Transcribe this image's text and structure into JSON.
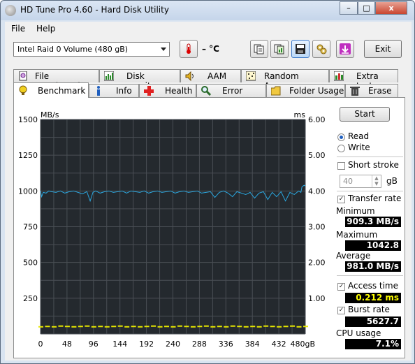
{
  "window": {
    "title": "HD Tune Pro 4.60 - Hard Disk Utility",
    "controls": {
      "minimize": "–",
      "maximize": "□",
      "close": "x"
    }
  },
  "menu": [
    {
      "label": "File"
    },
    {
      "label": "Help"
    }
  ],
  "toolbar": {
    "drive": "Intel   Raid 0 Volume (480 gB)",
    "temperature": "– °C",
    "exit_label": "Exit",
    "icons": [
      "copy-info-icon",
      "copy-screenshot-icon",
      "save-icon",
      "options-icon",
      "download-icon"
    ]
  },
  "tabs_row1": [
    {
      "label": "File Benchmark",
      "icon": "file-benchmark-icon"
    },
    {
      "label": "Disk monitor",
      "icon": "disk-monitor-icon"
    },
    {
      "label": "AAM",
      "icon": "speaker-icon"
    },
    {
      "label": "Random Access",
      "icon": "random-access-icon"
    },
    {
      "label": "Extra tests",
      "icon": "extra-tests-icon"
    }
  ],
  "tabs_row2": [
    {
      "label": "Benchmark",
      "icon": "benchmark-icon",
      "active": true
    },
    {
      "label": "Info",
      "icon": "info-icon"
    },
    {
      "label": "Health",
      "icon": "health-cross-icon"
    },
    {
      "label": "Error Scan",
      "icon": "magnifier-icon"
    },
    {
      "label": "Folder Usage",
      "icon": "folder-icon"
    },
    {
      "label": "Erase",
      "icon": "trash-icon"
    }
  ],
  "side": {
    "start_label": "Start",
    "read_label": "Read",
    "write_label": "Write",
    "mode": "read",
    "short_stroke_label": "Short stroke",
    "short_stroke_checked": false,
    "stroke_value": "40",
    "stroke_unit": "gB",
    "transfer_rate_label": "Transfer rate",
    "transfer_rate_checked": true,
    "minimum_label": "Minimum",
    "minimum_value": "909.3 MB/s",
    "maximum_label": "Maximum",
    "maximum_value": "1042.8 MB/s",
    "average_label": "Average",
    "average_value": "981.0 MB/s",
    "access_time_label": "Access time",
    "access_time_checked": true,
    "access_time_value": "0.212 ms",
    "burst_rate_label": "Burst rate",
    "burst_rate_checked": true,
    "burst_rate_value": "5627.7 MB/s",
    "cpu_label": "CPU usage",
    "cpu_value": "7.1%"
  },
  "colors": {
    "plot_bg": "#24292e",
    "grid": "#4a4f55",
    "transfer_line": "#2aa6de",
    "access_points": "#e6e600",
    "value_yellow": "#ffff00"
  },
  "chart_data": {
    "type": "line",
    "ylabel": "MB/s",
    "y2label": "ms",
    "ylim": [
      0,
      1500
    ],
    "y2lim": [
      0,
      6.0
    ],
    "xlim": [
      0,
      480
    ],
    "y_ticks": [
      "1500",
      "1250",
      "1000",
      "750",
      "500",
      "250"
    ],
    "y2_ticks": [
      "6.00",
      "5.00",
      "4.00",
      "3.00",
      "2.00",
      "1.00"
    ],
    "x_ticks": [
      "0",
      "48",
      "96",
      "144",
      "192",
      "240",
      "288",
      "336",
      "384",
      "432",
      "480gB"
    ],
    "grid": true,
    "series": [
      {
        "axis": "left",
        "x": [
          0,
          2,
          5,
          10,
          15,
          20,
          28,
          36,
          44,
          52,
          60,
          68,
          76,
          84,
          90,
          95,
          100,
          108,
          116,
          124,
          132,
          140,
          148,
          156,
          164,
          172,
          180,
          188,
          196,
          204,
          212,
          220,
          228,
          236,
          244,
          252,
          260,
          268,
          276,
          284,
          292,
          300,
          308,
          316,
          324,
          332,
          340,
          348,
          356,
          364,
          372,
          380,
          388,
          396,
          404,
          412,
          420,
          428,
          436,
          444,
          452,
          460,
          468,
          472,
          474,
          478,
          480
        ],
        "y": [
          1000,
          960,
          990,
          985,
          1000,
          995,
          990,
          1000,
          985,
          995,
          1000,
          990,
          980,
          995,
          930,
          990,
          1000,
          985,
          995,
          1000,
          990,
          995,
          1000,
          985,
          1000,
          995,
          990,
          1000,
          985,
          995,
          1000,
          990,
          995,
          1000,
          985,
          995,
          1000,
          990,
          995,
          1000,
          985,
          990,
          995,
          955,
          990,
          1000,
          985,
          960,
          995,
          985,
          975,
          990,
          950,
          985,
          995,
          940,
          990,
          960,
          995,
          930,
          990,
          975,
          1000,
          990,
          1030,
          1040,
          1035
        ]
      },
      {
        "axis": "right",
        "x": [
          0,
          12,
          24,
          36,
          48,
          60,
          72,
          84,
          96,
          108,
          120,
          132,
          144,
          156,
          168,
          180,
          192,
          204,
          216,
          228,
          240,
          252,
          264,
          276,
          288,
          300,
          312,
          324,
          336,
          348,
          360,
          372,
          384,
          396,
          408,
          420,
          432,
          444,
          456,
          468,
          480
        ],
        "y": [
          0.2,
          0.21,
          0.2,
          0.22,
          0.21,
          0.2,
          0.21,
          0.22,
          0.2,
          0.21,
          0.2,
          0.21,
          0.22,
          0.2,
          0.21,
          0.2,
          0.21,
          0.22,
          0.2,
          0.21,
          0.2,
          0.22,
          0.21,
          0.2,
          0.21,
          0.22,
          0.2,
          0.21,
          0.2,
          0.22,
          0.21,
          0.2,
          0.21,
          0.2,
          0.22,
          0.21,
          0.2,
          0.21,
          0.22,
          0.2,
          0.21
        ]
      }
    ]
  }
}
